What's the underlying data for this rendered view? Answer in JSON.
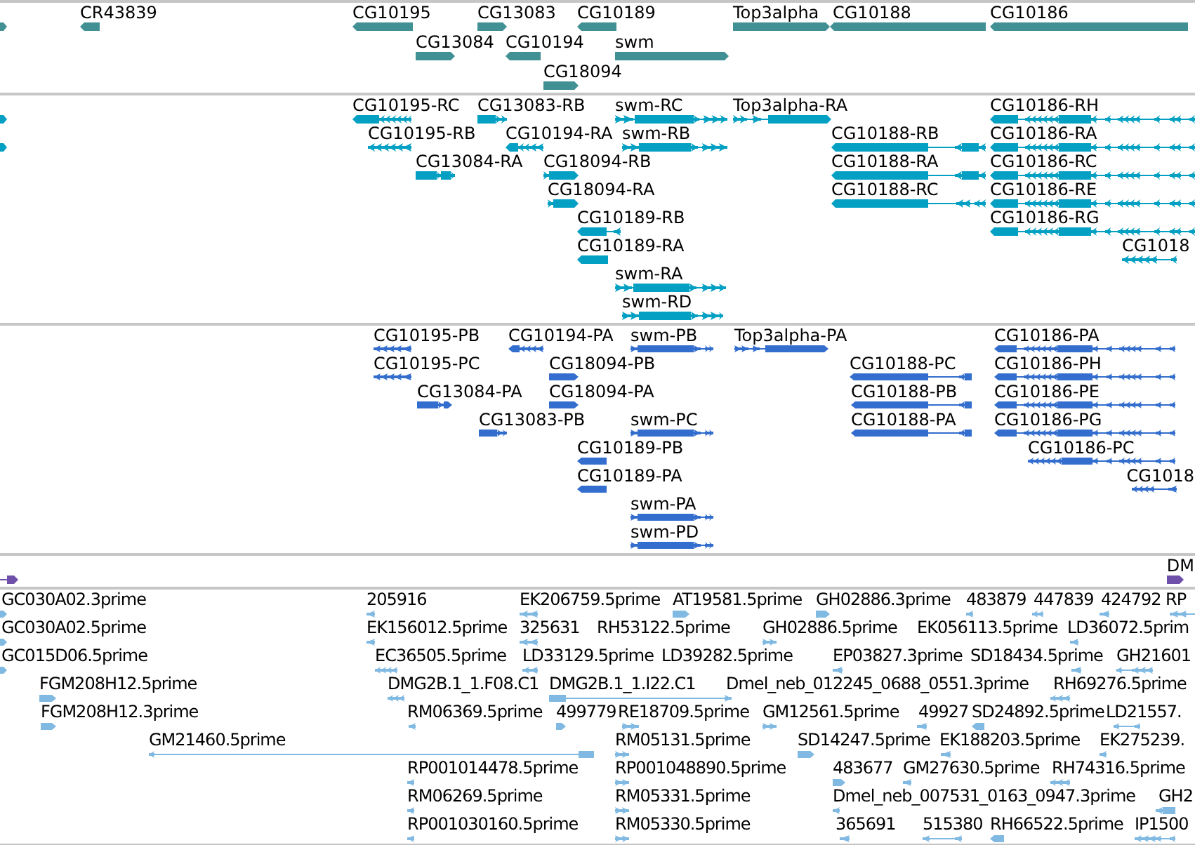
{
  "tracks": [
    {
      "kind": "gene",
      "color": "#409094",
      "lanes": [
        {
          "features": [
            {
              "reverse": false
            },
            {
              "label": "CR43839",
              "reverse": true
            },
            {
              "label": "CG10195",
              "reverse": true
            },
            {
              "label": "CG13083",
              "reverse": false
            },
            {
              "label": "CG10189",
              "reverse": true
            },
            {
              "label": "Top3alpha",
              "reverse": false
            },
            {
              "label": "CG10188",
              "reverse": true
            },
            {
              "label": "CG10186",
              "reverse": true
            }
          ]
        },
        {
          "features": [
            {
              "label": "CG13084",
              "reverse": false
            },
            {
              "label": "CG10194",
              "reverse": true
            },
            {
              "label": "swm",
              "reverse": false
            }
          ]
        },
        {
          "features": [
            {
              "label": "CG18094",
              "reverse": false
            }
          ]
        }
      ]
    },
    {
      "kind": "transcript",
      "color": "#04a0c3",
      "lanes": [
        {
          "features": [
            {
              "reverse": false
            },
            {
              "label": "CG10195-RC",
              "reverse": true
            },
            {
              "label": "CG13083-RB",
              "reverse": false
            },
            {
              "label": "swm-RC",
              "reverse": false
            },
            {
              "label": "Top3alpha-RA",
              "reverse": false
            },
            {
              "label": "CG10186-RH",
              "reverse": true
            }
          ]
        },
        {
          "features": [
            {
              "reverse": false
            },
            {
              "label": "CG10195-RB",
              "reverse": true
            },
            {
              "label": "CG10194-RA",
              "reverse": true
            },
            {
              "label": "swm-RB",
              "reverse": false
            },
            {
              "label": "CG10188-RB",
              "reverse": true
            },
            {
              "label": "CG10186-RA",
              "reverse": true
            }
          ]
        },
        {
          "features": [
            {
              "label": "CG13084-RA",
              "reverse": false
            },
            {
              "label": "CG18094-RB",
              "reverse": false
            },
            {
              "label": "CG10188-RA",
              "reverse": true
            },
            {
              "label": "CG10186-RC",
              "reverse": true
            }
          ]
        },
        {
          "features": [
            {
              "label": "CG18094-RA",
              "reverse": false
            },
            {
              "label": "CG10188-RC",
              "reverse": true
            },
            {
              "label": "CG10186-RE",
              "reverse": true
            }
          ]
        },
        {
          "features": [
            {
              "label": "CG10189-RB",
              "reverse": true
            },
            {
              "label": "CG10186-RG",
              "reverse": true
            }
          ]
        },
        {
          "features": [
            {
              "label": "CG10189-RA",
              "reverse": true
            },
            {
              "label": "CG1018",
              "reverse": true
            }
          ]
        },
        {
          "features": [
            {
              "label": "swm-RA",
              "reverse": false
            }
          ]
        },
        {
          "features": [
            {
              "label": "swm-RD",
              "reverse": false
            }
          ]
        }
      ]
    },
    {
      "kind": "protein",
      "color": "#336ece",
      "lanes": [
        {
          "features": [
            {
              "label": "CG10195-PB",
              "reverse": true
            },
            {
              "label": "CG10194-PA",
              "reverse": true
            },
            {
              "label": "swm-PB",
              "reverse": false
            },
            {
              "label": "Top3alpha-PA",
              "reverse": false
            },
            {
              "label": "CG10186-PA",
              "reverse": true
            }
          ]
        },
        {
          "features": [
            {
              "label": "CG10195-PC",
              "reverse": true
            },
            {
              "label": "CG18094-PB",
              "reverse": false
            },
            {
              "label": "CG10188-PC",
              "reverse": true
            },
            {
              "label": "CG10186-PH",
              "reverse": true
            }
          ]
        },
        {
          "features": [
            {
              "label": "CG13084-PA",
              "reverse": false
            },
            {
              "label": "CG18094-PA",
              "reverse": false
            },
            {
              "label": "CG10188-PB",
              "reverse": true
            },
            {
              "label": "CG10186-PE",
              "reverse": true
            }
          ]
        },
        {
          "features": [
            {
              "label": "CG13083-PB",
              "reverse": false
            },
            {
              "label": "swm-PC",
              "reverse": false
            },
            {
              "label": "CG10188-PA",
              "reverse": true
            },
            {
              "label": "CG10186-PG",
              "reverse": true
            }
          ]
        },
        {
          "features": [
            {
              "label": "CG10189-PB",
              "reverse": true
            },
            {
              "label": "CG10186-PC",
              "reverse": true
            }
          ]
        },
        {
          "features": [
            {
              "label": "CG10189-PA",
              "reverse": true
            },
            {
              "label": "CG1018",
              "reverse": true
            }
          ]
        },
        {
          "features": [
            {
              "label": "swm-PA",
              "reverse": false
            }
          ]
        },
        {
          "features": [
            {
              "label": "swm-PD",
              "reverse": false
            }
          ]
        }
      ]
    },
    {
      "kind": "region",
      "color": "#6e50aa",
      "lanes": [
        {
          "features": [
            {
              "reverse": false
            },
            {
              "label": "DM",
              "reverse": false
            }
          ]
        }
      ]
    },
    {
      "kind": "est",
      "color": "#80b9e2",
      "lanes": [
        {
          "features": [
            {
              "label": "GC030A02.3prime",
              "reverse": false
            },
            {
              "label": "205916",
              "reverse": true
            },
            {
              "label": "EK206759.5prime",
              "reverse": true
            },
            {
              "label": "AT19581.5prime",
              "reverse": false
            },
            {
              "label": "GH02886.3prime",
              "reverse": false
            },
            {
              "label": "483879",
              "reverse": true
            },
            {
              "label": "447839",
              "reverse": true
            },
            {
              "label": "424792",
              "reverse": true
            },
            {
              "label": "RP",
              "reverse": true
            }
          ]
        },
        {
          "features": [
            {
              "label": "GC030A02.5prime",
              "reverse": false
            },
            {
              "label": "EK156012.5prime",
              "reverse": true
            },
            {
              "label": "325631",
              "reverse": true
            },
            {
              "label": "RH53122.5prime"
            },
            {
              "label": "GH02886.5prime",
              "reverse": false
            },
            {
              "label": "EK056113.5prime"
            },
            {
              "label": "LD36072.5prim",
              "reverse": true
            }
          ]
        },
        {
          "features": [
            {
              "label": "GC015D06.5prime",
              "reverse": false
            },
            {
              "label": "EC36505.5prime",
              "reverse": true
            },
            {
              "label": "LD33129.5prime",
              "reverse": true
            },
            {
              "label": "LD39282.5prime"
            },
            {
              "label": "EP03827.3prime",
              "reverse": true
            },
            {
              "label": "SD18434.5prime",
              "reverse": true
            },
            {
              "label": "GH21601",
              "reverse": true
            }
          ]
        },
        {
          "features": [
            {
              "label": "FGM208H12.5prime",
              "reverse": false
            },
            {
              "label": "DMG2B.1_1.F08.C1",
              "reverse": true
            },
            {
              "label": "DMG2B.1_1.I22.C1",
              "reverse": false
            },
            {
              "label": "Dmel_neb_012245_0688_0551.3prime"
            },
            {
              "label": "RH69276.5prime",
              "reverse": true
            }
          ]
        },
        {
          "features": [
            {
              "label": "FGM208H12.3prime",
              "reverse": false
            },
            {
              "label": "RM06369.5prime",
              "reverse": true
            },
            {
              "label": "499779",
              "reverse": false
            },
            {
              "label": "RE18709.5prime",
              "reverse": false
            },
            {
              "label": "GM12561.5prime",
              "reverse": false
            },
            {
              "label": "49927",
              "reverse": true
            },
            {
              "label": "SD24892.5prime",
              "reverse": true
            },
            {
              "label": "LD21557.",
              "reverse": true
            }
          ]
        },
        {
          "features": [
            {
              "label": "GM21460.5prime",
              "reverse": true
            },
            {
              "label": "RM05131.5prime",
              "reverse": false
            },
            {
              "label": "SD14247.5prime",
              "reverse": false
            },
            {
              "label": "EK188203.5prime",
              "reverse": true
            },
            {
              "label": "EK275239.",
              "reverse": true
            }
          ]
        },
        {
          "features": [
            {
              "label": "RP001014478.5prime",
              "reverse": true
            },
            {
              "label": "RP001048890.5prime",
              "reverse": false
            },
            {
              "label": "483677",
              "reverse": false
            },
            {
              "label": "GM27630.5prime",
              "reverse": true
            },
            {
              "label": "RH74316.5prime",
              "reverse": true
            }
          ]
        },
        {
          "features": [
            {
              "label": "RM06269.5prime",
              "reverse": true
            },
            {
              "label": "RM05331.5prime",
              "reverse": false
            },
            {
              "label": "Dmel_neb_007531_0163_0947.3prime",
              "reverse": true
            },
            {
              "label": "GH2",
              "reverse": true
            }
          ]
        },
        {
          "features": [
            {
              "label": "RP001030160.5prime",
              "reverse": true
            },
            {
              "label": "RM05330.5prime",
              "reverse": false
            },
            {
              "label": "365691",
              "reverse": true
            },
            {
              "label": "515380",
              "reverse": true
            },
            {
              "label": "RH66522.5prime",
              "reverse": true
            },
            {
              "label": "IP1500",
              "reverse": true
            }
          ]
        }
      ]
    }
  ]
}
